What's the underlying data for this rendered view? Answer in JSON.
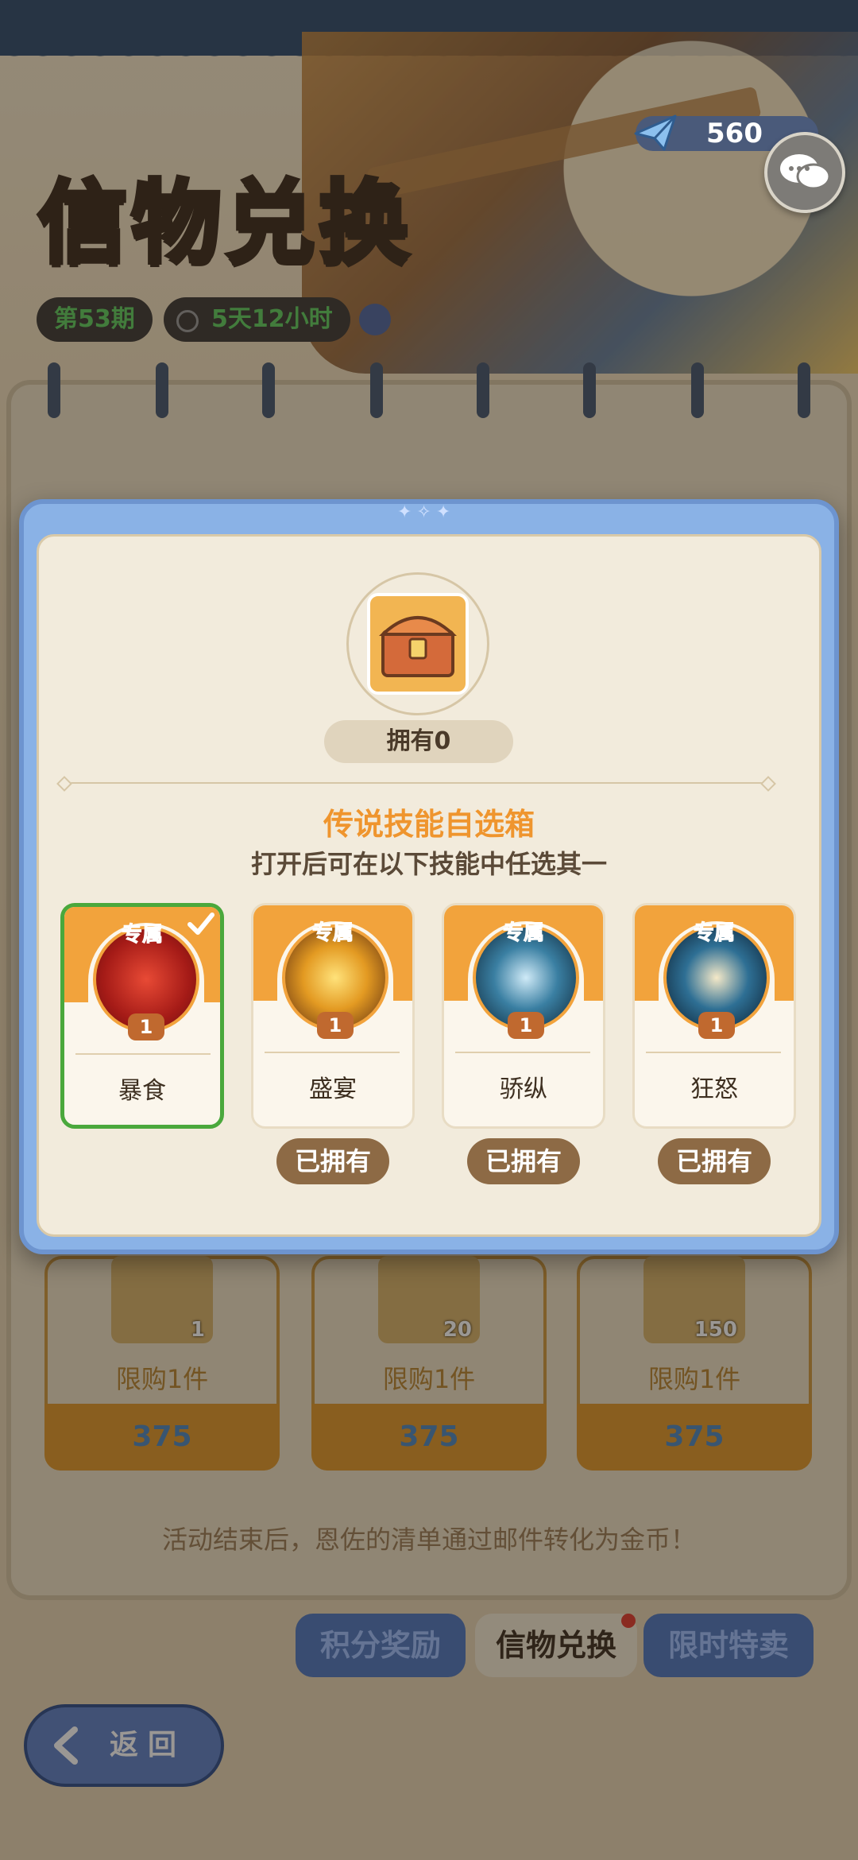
{
  "background": {
    "title": "信物兑换",
    "period_badge": "第53期",
    "timer_badge": "5天12小时",
    "currency_value": "560",
    "shop_items": [
      {
        "qty": "1",
        "limit": "限购1件",
        "price": "375"
      },
      {
        "qty": "20",
        "limit": "限购1件",
        "price": "375"
      },
      {
        "qty": "150",
        "limit": "限购1件",
        "price": "375"
      }
    ],
    "notice": "活动结束后，恩佐的清单通过邮件转化为金币！",
    "tabs": [
      {
        "label": "积分奖励"
      },
      {
        "label": "信物兑换"
      },
      {
        "label": "限时特卖"
      }
    ],
    "back_label": "返回"
  },
  "modal": {
    "owned": "拥有0",
    "item_name": "传说技能自选箱",
    "item_desc": "打开后可在以下技能中任选其一",
    "skills": [
      {
        "tag": "专属",
        "level": "1",
        "name": "暴食",
        "selected": true,
        "owned_label": ""
      },
      {
        "tag": "专属",
        "level": "1",
        "name": "盛宴",
        "selected": false,
        "owned_label": "已拥有"
      },
      {
        "tag": "专属",
        "level": "1",
        "name": "骄纵",
        "selected": false,
        "owned_label": "已拥有"
      },
      {
        "tag": "专属",
        "level": "1",
        "name": "狂怒",
        "selected": false,
        "owned_label": "已拥有"
      }
    ]
  },
  "colors": {
    "accent_orange": "#ef952e",
    "selected_green": "#4aa83c",
    "modal_blue": "#8ab2e6"
  }
}
